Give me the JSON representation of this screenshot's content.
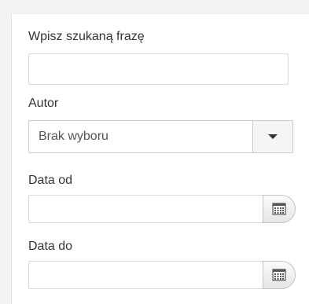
{
  "search": {
    "label": "Wpisz szukaną frazę",
    "value": ""
  },
  "author": {
    "label": "Autor",
    "selected": "Brak wyboru"
  },
  "date_from": {
    "label": "Data od",
    "value": "",
    "icon": "calendar-icon"
  },
  "date_to": {
    "label": "Data do",
    "value": "",
    "icon": "calendar-icon"
  },
  "colors": {
    "background": "#f3f3f3",
    "panel": "#ffffff",
    "border": "#d9d9d9",
    "text": "#333333"
  }
}
